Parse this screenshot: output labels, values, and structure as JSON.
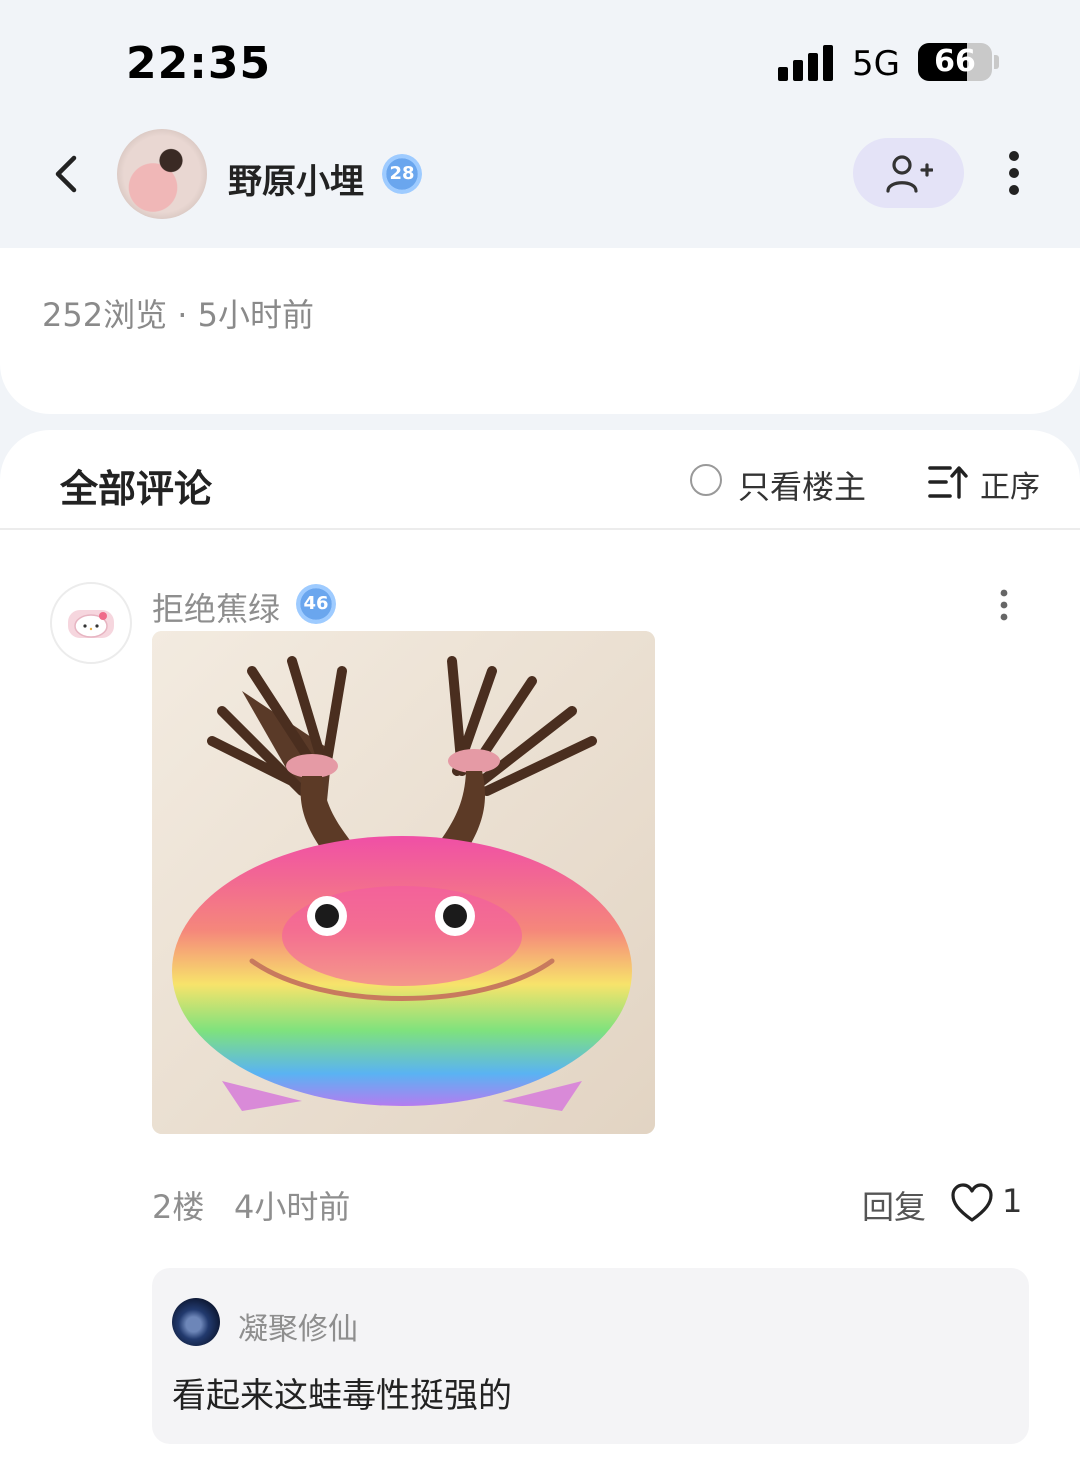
{
  "status_bar": {
    "time": "22:35",
    "network": "5G",
    "battery_percent": "66",
    "battery_level": 0.66,
    "signal_bars": 4
  },
  "header": {
    "back_icon": "chevron-left-icon",
    "username": "野原小埋",
    "level": "28",
    "follow_icon": "user-plus-icon",
    "more_icon": "more-vertical-icon"
  },
  "post": {
    "views_and_time": "252浏览 · 5小时前"
  },
  "comments": {
    "title": "全部评论",
    "only_owner_label": "只看楼主",
    "sort_label": "正序",
    "sort_icon": "sort-ascending-icon",
    "items": [
      {
        "author": "拒绝蕉绿",
        "level": "46",
        "image_icon": "rainbow-frog-with-braids-image",
        "floor": "2楼",
        "time": "4小时前",
        "reply_label": "回复",
        "like_icon": "heart-icon",
        "likes": "1",
        "replies": [
          {
            "author": "凝聚修仙",
            "text": "看起来这蛙毒性挺强的"
          }
        ]
      }
    ]
  },
  "colors": {
    "background": "#f1f4f8",
    "follow_button_bg": "#e4e3f7",
    "level_badge": "#6aa6ee",
    "muted_text": "#8e8e8e"
  }
}
